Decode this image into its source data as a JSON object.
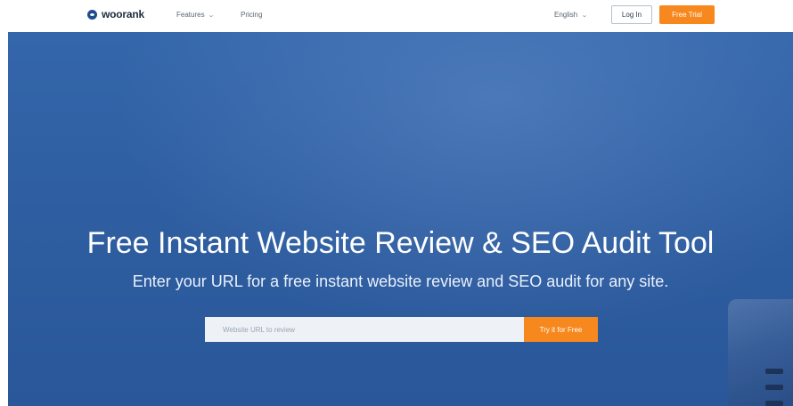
{
  "header": {
    "brand": "woorank",
    "nav": {
      "features_label": "Features",
      "pricing_label": "Pricing"
    },
    "language_label": "English",
    "login_label": "Log In",
    "free_trial_label": "Free Trial"
  },
  "hero": {
    "title": "Free Instant Website Review & SEO Audit Tool",
    "subtitle": "Enter your URL for a free instant website review and SEO audit for any site.",
    "search": {
      "value": "",
      "placeholder": "Website URL to review"
    },
    "cta_label": "Try it for Free"
  },
  "icons": {
    "logo": "woorank-logo-icon",
    "features_dropdown": "chevron-down-icon",
    "language_dropdown": "chevron-down-icon"
  },
  "colors": {
    "accent": "#f7881e",
    "hero_background": "#2d5c9f",
    "brand": "#1f4c8f"
  }
}
